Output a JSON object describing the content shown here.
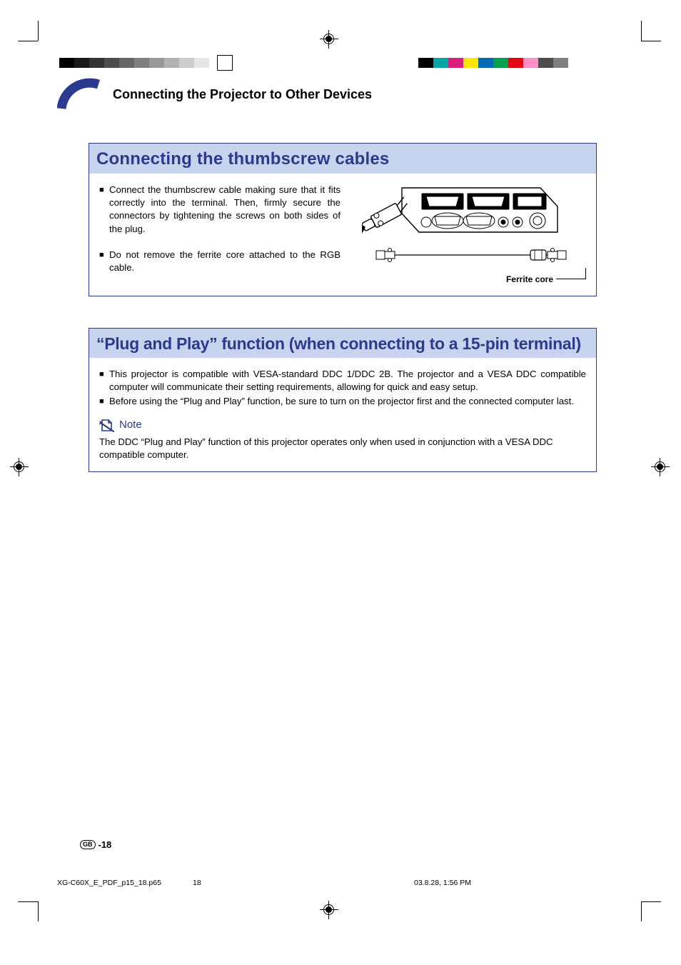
{
  "section_title": "Connecting the Projector to Other Devices",
  "box1": {
    "header": "Connecting the thumbscrew cables",
    "bullets": [
      "Connect the thumbscrew cable making sure that it fits correctly into the terminal. Then, firmly secure the connectors by tightening the screws on both sides of the plug.",
      "Do not remove the ferrite core attached to the RGB cable."
    ],
    "ferrite_label": "Ferrite core"
  },
  "box2": {
    "header": "“Plug and Play” function (when connecting to a 15-pin terminal)",
    "bullets": [
      "This projector is compatible with VESA-standard DDC 1/DDC 2B. The projector and a VESA DDC compatible computer will communicate their setting requirements, allowing for quick and easy setup.",
      "Before using the “Plug and Play” function, be sure to turn on the projector first and the connected computer last."
    ],
    "note_label": "Note",
    "note_text": "The DDC “Plug and Play” function of this projector operates only when used in conjunction with a VESA DDC compatible computer."
  },
  "page_number": "-18",
  "gb_label": "GB",
  "footer": {
    "filename": "XG-C60X_E_PDF_p15_18.p65",
    "page": "18",
    "timestamp": "03.8.28, 1:56 PM"
  },
  "grad_colors": [
    "#000000",
    "#1a1a1a",
    "#333333",
    "#4d4d4d",
    "#666666",
    "#808080",
    "#999999",
    "#b3b3b3",
    "#cccccc",
    "#e6e6e6"
  ],
  "cmyk_colors": [
    "#000000",
    "#00a6a6",
    "#d91f7a",
    "#ffe600",
    "#006bb3",
    "#00a04a",
    "#e30613",
    "#ff8fc7",
    "#4d4d4d",
    "#808080"
  ]
}
